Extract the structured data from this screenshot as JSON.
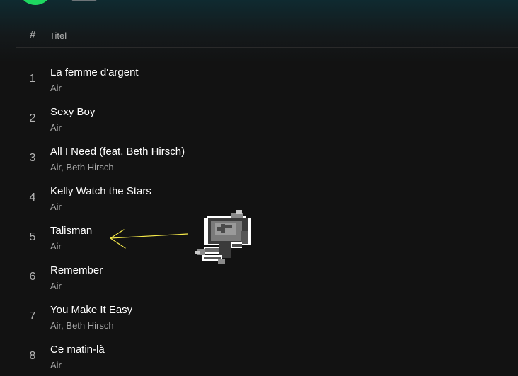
{
  "header": {
    "number_label": "#",
    "title_label": "Titel"
  },
  "tracks": [
    {
      "number": "1",
      "title": "La femme d'argent",
      "artist": "Air"
    },
    {
      "number": "2",
      "title": "Sexy Boy",
      "artist": "Air"
    },
    {
      "number": "3",
      "title": "All I Need (feat. Beth Hirsch)",
      "artist": "Air, Beth Hirsch"
    },
    {
      "number": "4",
      "title": "Kelly Watch the Stars",
      "artist": "Air"
    },
    {
      "number": "5",
      "title": "Talisman",
      "artist": "Air"
    },
    {
      "number": "6",
      "title": "Remember",
      "artist": "Air"
    },
    {
      "number": "7",
      "title": "You Make It Easy",
      "artist": "Air, Beth Hirsch"
    },
    {
      "number": "8",
      "title": "Ce matin-là",
      "artist": "Air"
    }
  ],
  "colors": {
    "background": "#121212",
    "accent": "#1ed760",
    "annotation_arrow": "#f5e94a"
  }
}
